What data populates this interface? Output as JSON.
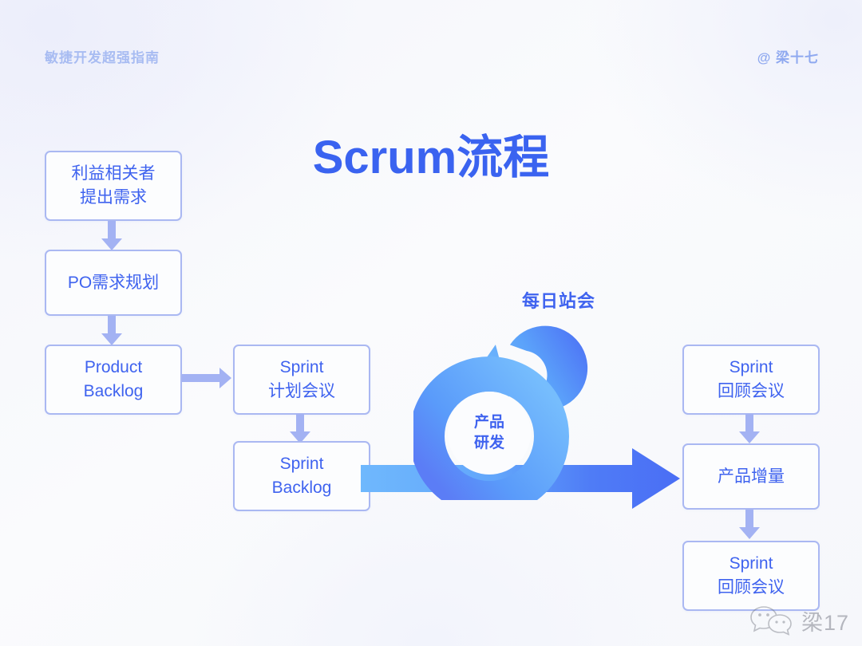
{
  "header": {
    "left_label": "敏捷开发超强指南",
    "right_handle": "@ 梁十七"
  },
  "title": "Scrum流程",
  "colors": {
    "title_blue": "#3a63f0",
    "box_border": "#aab8f2",
    "box_text": "#3f63ef",
    "arrow_periwinkle": "#a3b2f3",
    "ring_light": "#6ab4fc",
    "ring_deep": "#4a6ef5",
    "header_text": "#a8bcf2",
    "background": "#f7f8fc"
  },
  "nodes": [
    {
      "id": "stakeholder",
      "lines": [
        "利益相关者",
        "提出需求"
      ]
    },
    {
      "id": "po-planning",
      "lines": [
        "PO需求规划"
      ]
    },
    {
      "id": "product-backlog",
      "lines": [
        "Product",
        "Backlog"
      ]
    },
    {
      "id": "sprint-planning",
      "lines": [
        "Sprint",
        "计划会议"
      ]
    },
    {
      "id": "sprint-backlog",
      "lines": [
        "Sprint",
        "Backlog"
      ]
    },
    {
      "id": "sprint-review",
      "lines": [
        "Sprint",
        "回顾会议"
      ]
    },
    {
      "id": "product-increment",
      "lines": [
        "产品增量"
      ]
    },
    {
      "id": "sprint-retro",
      "lines": [
        "Sprint",
        "回顾会议"
      ]
    }
  ],
  "rings": {
    "outer_label": "每日站会",
    "core_lines": [
      "产品",
      "研发"
    ]
  },
  "watermark": {
    "icon": "wechat-bubbles-icon",
    "text": "梁17"
  }
}
